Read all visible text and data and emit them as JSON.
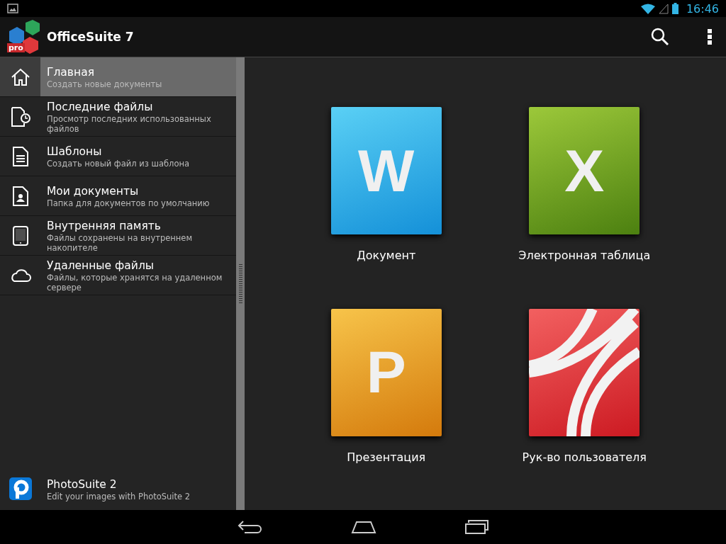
{
  "status_bar": {
    "time": "16:46"
  },
  "app_bar": {
    "title": "OfficeSuite 7",
    "logo_badge": "pro"
  },
  "sidebar": {
    "items": [
      {
        "kind": "home",
        "title": "Главная",
        "subtitle": "Создать новые документы",
        "selected": true
      },
      {
        "kind": "recent",
        "title": "Последние файлы",
        "subtitle": "Просмотр последних использованных файлов",
        "selected": false
      },
      {
        "kind": "template",
        "title": "Шаблоны",
        "subtitle": "Создать новый файл из шаблона",
        "selected": false
      },
      {
        "kind": "mydocs",
        "title": "Мои документы",
        "subtitle": "Папка для документов по умолчанию",
        "selected": false
      },
      {
        "kind": "storage",
        "title": "Внутренняя память",
        "subtitle": "Файлы сохранены на внутреннем накопителе",
        "selected": false
      },
      {
        "kind": "cloud",
        "title": "Удаленные файлы",
        "subtitle": "Файлы, которые хранятся на удаленном сервере",
        "selected": false
      }
    ],
    "promo": {
      "title": "PhotoSuite 2",
      "subtitle": "Edit your images with PhotoSuite 2"
    }
  },
  "tiles": [
    {
      "kind": "document",
      "letter": "W",
      "label": "Документ"
    },
    {
      "kind": "spreadsheet",
      "letter": "X",
      "label": "Электронная таблица"
    },
    {
      "kind": "presentation",
      "letter": "P",
      "label": "Презентация"
    },
    {
      "kind": "guide",
      "label": "Рук-во пользователя"
    }
  ]
}
